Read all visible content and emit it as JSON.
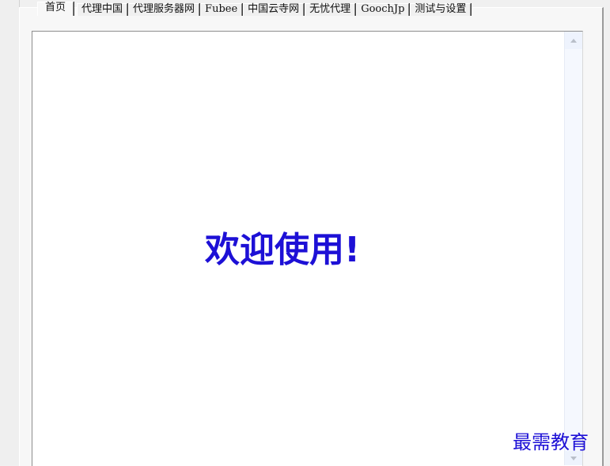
{
  "tabs": [
    {
      "label": "首页",
      "active": true
    },
    {
      "label": "代理中国",
      "active": false
    },
    {
      "label": "代理服务器网",
      "active": false
    },
    {
      "label": "Fubee",
      "active": false
    },
    {
      "label": "中国云寺网",
      "active": false
    },
    {
      "label": "无忧代理",
      "active": false
    },
    {
      "label": "GoochJp",
      "active": false
    },
    {
      "label": "测试与设置",
      "active": false
    }
  ],
  "content": {
    "welcome_text": "欢迎使用!"
  },
  "watermark": "最需教育",
  "colors": {
    "welcome": "#1d10d6",
    "watermark": "#1d10d6",
    "window_bg": "#f0f0f0",
    "scrollbar_track": "#f5f8fe"
  }
}
